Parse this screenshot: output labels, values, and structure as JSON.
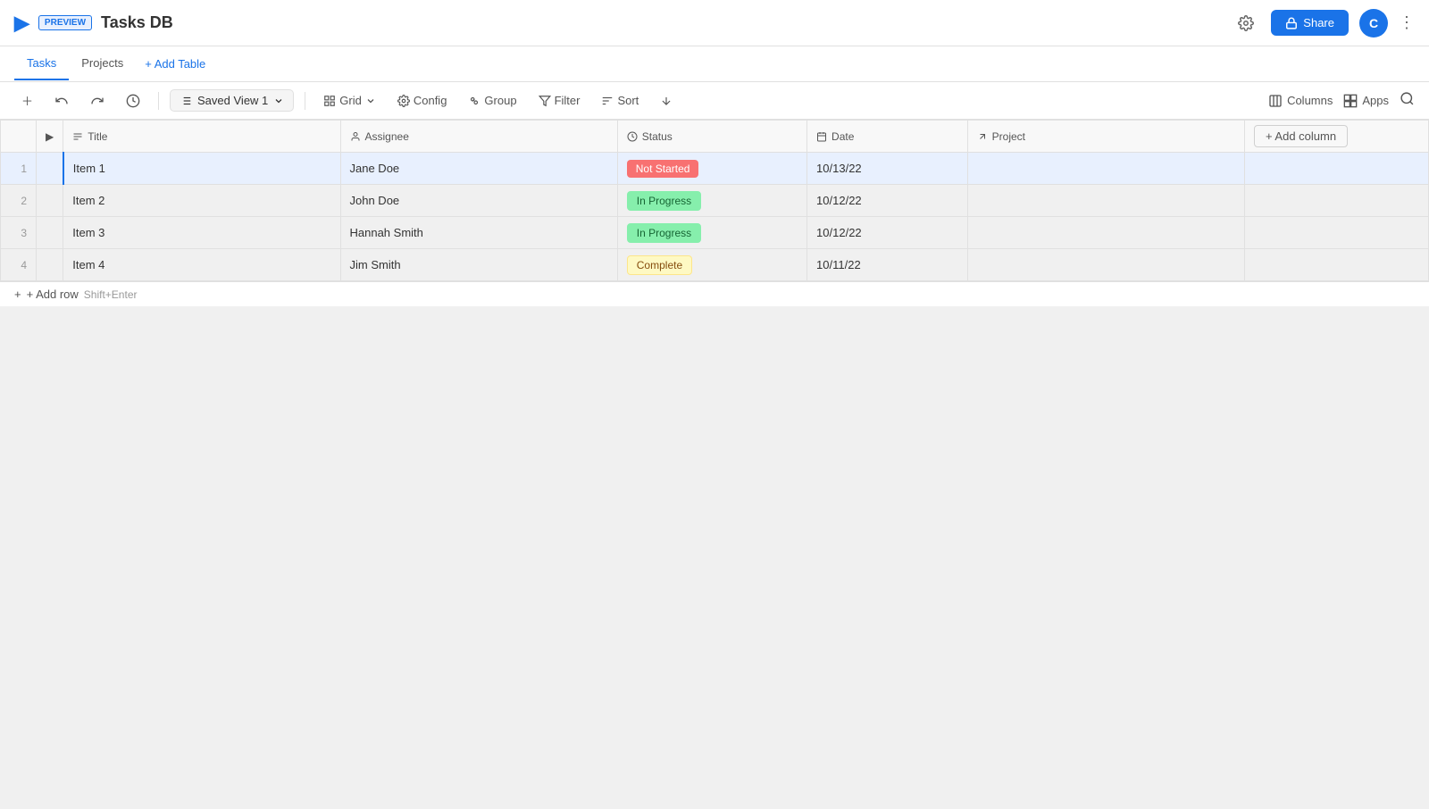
{
  "preview_badge": "PREVIEW",
  "app_title": "Tasks DB",
  "nav": {
    "tabs": [
      "Tasks",
      "Projects"
    ],
    "active_tab": "Tasks",
    "add_table_label": "+ Add Table"
  },
  "toolbar": {
    "add_label": "+",
    "undo_label": "↩",
    "redo_label": "↪",
    "history_label": "⏱",
    "saved_view_label": "Saved View 1",
    "grid_label": "Grid",
    "config_label": "Config",
    "group_label": "Group",
    "filter_label": "Filter",
    "sort_label": "Sort"
  },
  "toolbar_right": {
    "columns_label": "Columns",
    "apps_label": "Apps"
  },
  "share_button": "Share",
  "avatar_letter": "C",
  "table": {
    "columns": [
      {
        "id": "title",
        "label": "Title",
        "icon": "text"
      },
      {
        "id": "assignee",
        "label": "Assignee",
        "icon": "person"
      },
      {
        "id": "status",
        "label": "Status",
        "icon": "clock"
      },
      {
        "id": "date",
        "label": "Date",
        "icon": "calendar"
      },
      {
        "id": "project",
        "label": "Project",
        "icon": "arrow"
      }
    ],
    "add_column_label": "+ Add column",
    "rows": [
      {
        "num": 1,
        "title": "Item 1",
        "assignee": "Jane Doe",
        "status": "Not Started",
        "status_type": "not-started",
        "date": "10/13/22",
        "project": "",
        "selected": true
      },
      {
        "num": 2,
        "title": "Item 2",
        "assignee": "John Doe",
        "status": "In Progress",
        "status_type": "in-progress",
        "date": "10/12/22",
        "project": ""
      },
      {
        "num": 3,
        "title": "Item 3",
        "assignee": "Hannah Smith",
        "status": "In Progress",
        "status_type": "in-progress",
        "date": "10/12/22",
        "project": ""
      },
      {
        "num": 4,
        "title": "Item 4",
        "assignee": "Jim Smith",
        "status": "Complete",
        "status_type": "complete",
        "date": "10/11/22",
        "project": ""
      }
    ],
    "add_row_label": "+ Add row",
    "add_row_shortcut": "Shift+Enter"
  }
}
